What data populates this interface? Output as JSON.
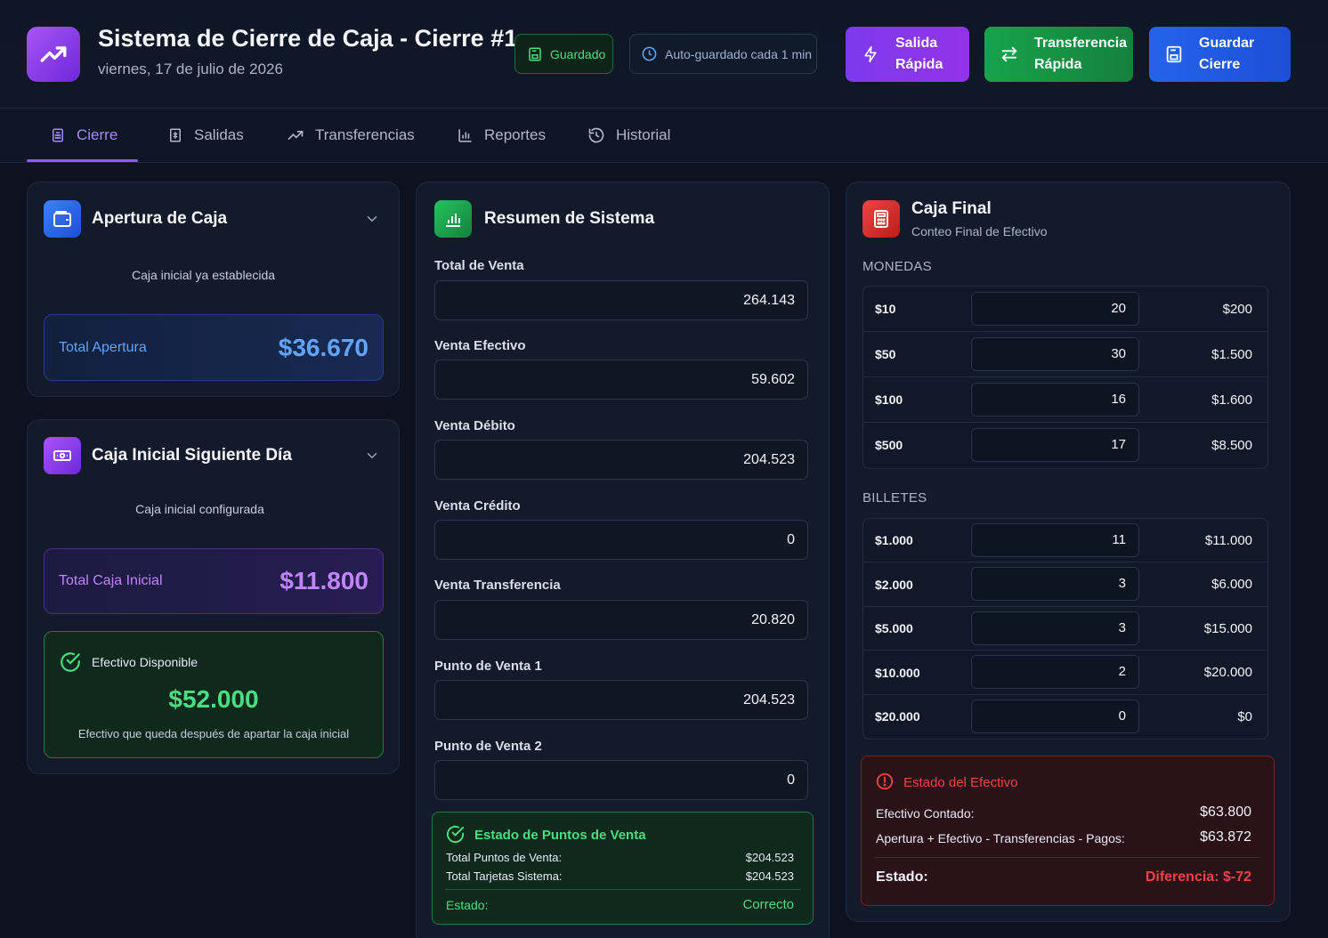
{
  "header": {
    "title": "Sistema de Cierre de Caja - Cierre #1",
    "date": "viernes, 17 de julio de 2026",
    "saved_badge": "Guardado",
    "autosave_badge": "Auto-guardado cada 1 min",
    "btn_salida": [
      "Salida",
      "Rápida"
    ],
    "btn_transferencia": [
      "Transferencia",
      "Rápida"
    ],
    "btn_guardar": [
      "Guardar",
      "Cierre"
    ]
  },
  "tabs": [
    {
      "label": "Cierre",
      "icon": "calculator-icon",
      "active": true
    },
    {
      "label": "Salidas",
      "icon": "receipt-icon",
      "active": false
    },
    {
      "label": "Transferencias",
      "icon": "trending-up-icon",
      "active": false
    },
    {
      "label": "Reportes",
      "icon": "bar-chart-icon",
      "active": false
    },
    {
      "label": "Historial",
      "icon": "history-icon",
      "active": false
    }
  ],
  "apertura": {
    "title": "Apertura de Caja",
    "note": "Caja inicial ya establecida",
    "total_label": "Total Apertura",
    "total_value": "$36.670"
  },
  "siguiente": {
    "title": "Caja Inicial Siguiente Día",
    "note": "Caja inicial configurada",
    "total_label": "Total Caja Inicial",
    "total_value": "$11.800",
    "efectivo_label": "Efectivo Disponible",
    "efectivo_value": "$52.000",
    "efectivo_note": "Efectivo que queda después de apartar la caja inicial"
  },
  "resumen": {
    "title": "Resumen de Sistema",
    "fields": [
      {
        "label": "Total de Venta",
        "value": "264.143"
      },
      {
        "label": "Venta Efectivo",
        "value": "59.602"
      },
      {
        "label": "Venta Débito",
        "value": "204.523"
      },
      {
        "label": "Venta Crédito",
        "value": "0"
      },
      {
        "label": "Venta Transferencia",
        "value": "20.820"
      },
      {
        "label": "Punto de Venta 1",
        "value": "204.523"
      },
      {
        "label": "Punto de Venta 2",
        "value": "0"
      }
    ],
    "estado_title": "Estado de Puntos de Venta",
    "total_pv_label": "Total Puntos de Venta:",
    "total_pv_value": "$204.523",
    "total_tarjetas_label": "Total Tarjetas Sistema:",
    "total_tarjetas_value": "$204.523",
    "estado_label": "Estado:",
    "estado_value": "Correcto"
  },
  "caja_final": {
    "title": "Caja Final",
    "subtitle": "Conteo Final de Efectivo",
    "monedas_label": "MONEDAS",
    "monedas": [
      {
        "d": "$10",
        "q": "20",
        "t": "$200"
      },
      {
        "d": "$50",
        "q": "30",
        "t": "$1.500"
      },
      {
        "d": "$100",
        "q": "16",
        "t": "$1.600"
      },
      {
        "d": "$500",
        "q": "17",
        "t": "$8.500"
      }
    ],
    "billetes_label": "BILLETES",
    "billetes": [
      {
        "d": "$1.000",
        "q": "11",
        "t": "$11.000"
      },
      {
        "d": "$2.000",
        "q": "3",
        "t": "$6.000"
      },
      {
        "d": "$5.000",
        "q": "3",
        "t": "$15.000"
      },
      {
        "d": "$10.000",
        "q": "2",
        "t": "$20.000"
      },
      {
        "d": "$20.000",
        "q": "0",
        "t": "$0"
      }
    ],
    "estado_title": "Estado del Efectivo",
    "contado_label": "Efectivo Contado:",
    "contado_value": "$63.800",
    "calc_label": "Apertura + Efectivo - Transferencias - Pagos:",
    "calc_value": "$63.872",
    "estado_label": "Estado:",
    "estado_value": "Diferencia: $-72"
  },
  "colors": {
    "accent_purple": "#8b5cf6",
    "green": "#22c55e",
    "blue": "#2563eb",
    "red": "#ef4444"
  }
}
